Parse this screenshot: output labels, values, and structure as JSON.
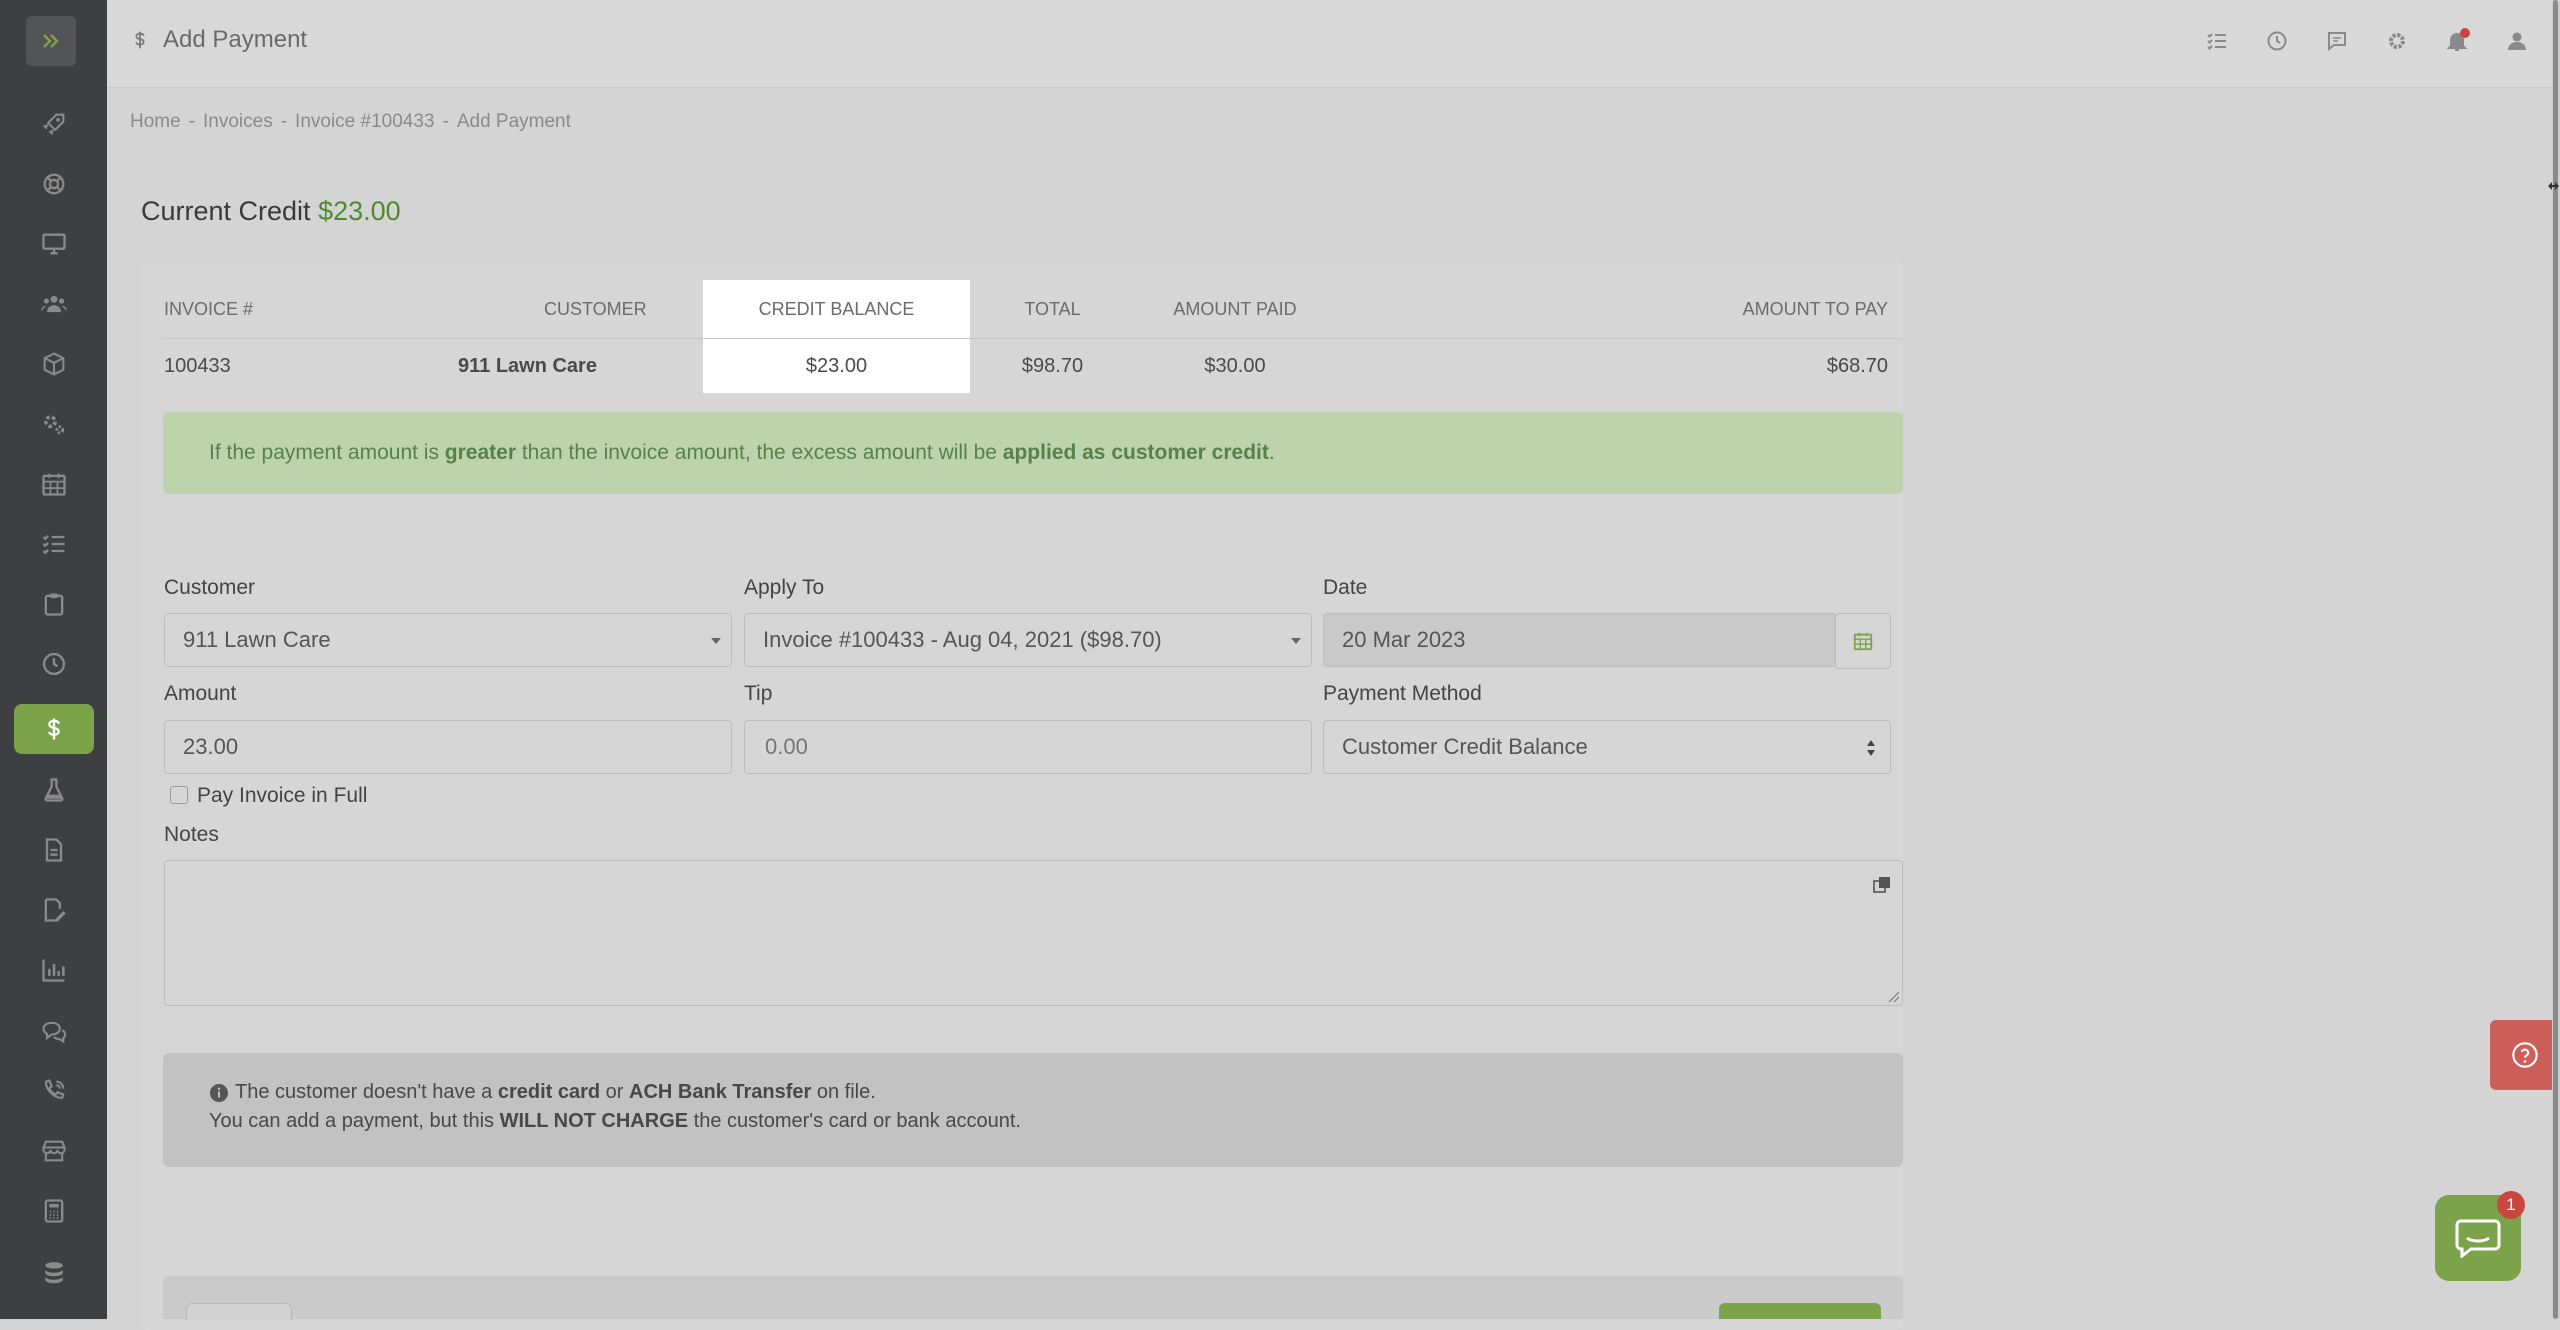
{
  "header": {
    "title": "Add Payment"
  },
  "breadcrumb": [
    "Home",
    "Invoices",
    "Invoice #100433",
    "Add Payment"
  ],
  "credit": {
    "label": "Current Credit",
    "amount": "$23.00"
  },
  "invoice_table": {
    "columns": [
      "INVOICE #",
      "CUSTOMER",
      "CREDIT BALANCE",
      "TOTAL",
      "AMOUNT PAID",
      "AMOUNT TO PAY"
    ],
    "row": {
      "invoice": "100433",
      "customer": "911 Lawn Care",
      "credit_balance": "$23.00",
      "total": "$98.70",
      "amount_paid": "$30.00",
      "amount_to_pay": "$68.70"
    }
  },
  "success_alert": {
    "p1": "If the payment amount is ",
    "b1": "greater",
    "p2": " than the invoice amount, the excess amount will be ",
    "b2": "applied as customer credit",
    "p3": "."
  },
  "form": {
    "customer_label": "Customer",
    "customer_value": "911 Lawn Care",
    "apply_to_label": "Apply To",
    "apply_to_value": "Invoice #100433 - Aug 04, 2021 ($98.70)",
    "date_label": "Date",
    "date_value": "20 Mar 2023",
    "amount_label": "Amount",
    "amount_value": "23.00",
    "tip_label": "Tip",
    "tip_placeholder": "0.00",
    "payment_method_label": "Payment Method",
    "payment_method_value": "Customer Credit Balance",
    "pay_full_label": "Pay Invoice in Full",
    "notes_label": "Notes"
  },
  "info_alert": {
    "l1_p1": "The customer doesn't have a ",
    "l1_b1": "credit card",
    "l1_p2": " or ",
    "l1_b2": "ACH Bank Transfer",
    "l1_p3": " on file.",
    "l2_p1": "You can add a payment, but this ",
    "l2_b1": "WILL NOT CHARGE",
    "l2_p2": " the customer's card or bank account."
  },
  "chat": {
    "badge": "1"
  },
  "colors": {
    "accent": "#7ba34a",
    "credit_green": "#4e8a2f",
    "due_red": "#c0504d",
    "sidebar": "#3e3f40"
  },
  "sidebar_icons": [
    "rocket-icon",
    "lifebuoy-icon",
    "monitor-icon",
    "users-icon",
    "box-icon",
    "gears-icon",
    "calendar-icon",
    "checklist-icon",
    "clipboard-icon",
    "clock-icon",
    "dollar-icon",
    "flask-icon",
    "document-icon",
    "signature-icon",
    "bar-chart-icon",
    "chat-icon",
    "phone-icon",
    "store-icon",
    "calculator-icon",
    "database-icon"
  ]
}
